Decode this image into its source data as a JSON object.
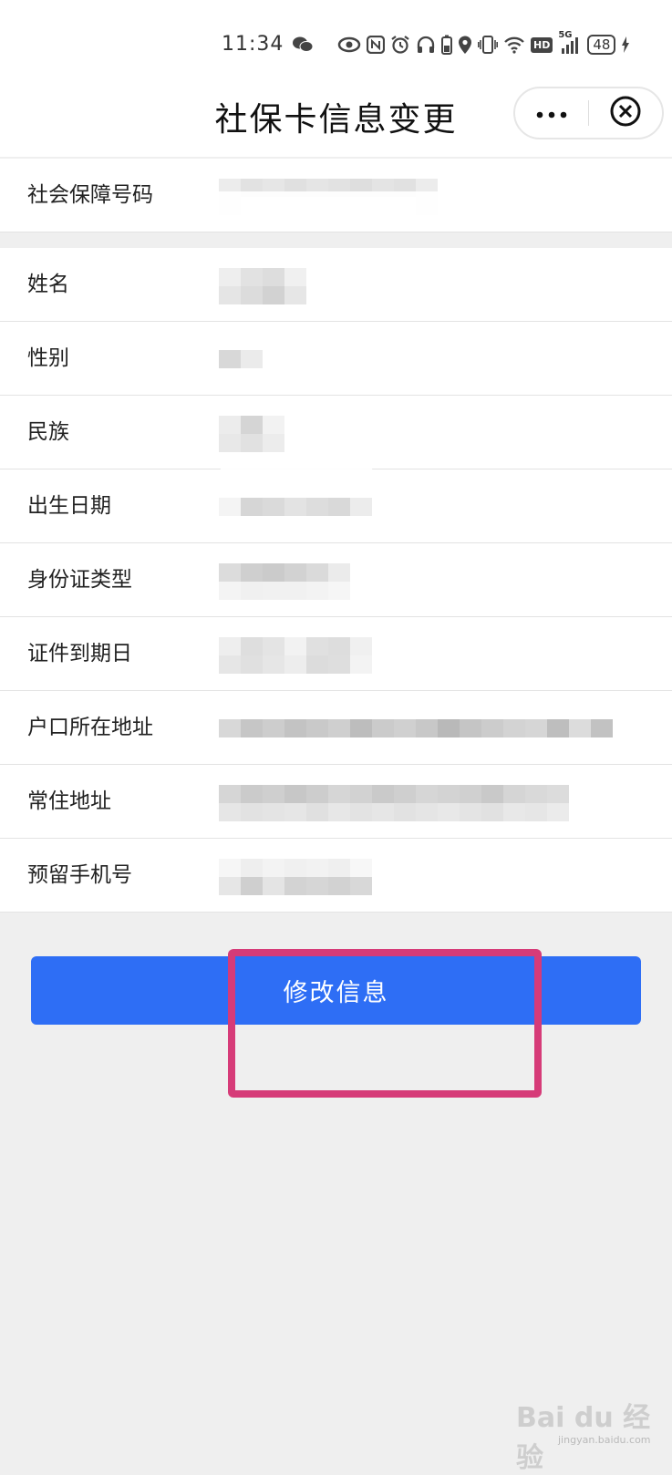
{
  "status_bar": {
    "time": "11:34",
    "network": "5G",
    "hd_label": "HD",
    "battery": "48",
    "icons": [
      "wechat-icon",
      "eye-icon",
      "nfc-icon",
      "alarm-icon",
      "headphones-icon",
      "battery-small-icon",
      "location-icon",
      "vibrate-icon",
      "wifi-icon",
      "hd-icon",
      "signal-icon",
      "charging-icon"
    ]
  },
  "nav": {
    "title": "社保卡信息变更",
    "more_icon": "more-icon",
    "close_icon": "close-icon"
  },
  "fields": {
    "ssn": "社会保障号码",
    "name": "姓名",
    "gender": "性别",
    "ethnicity": "民族",
    "birth_date": "出生日期",
    "id_type": "身份证类型",
    "id_expiry": "证件到期日",
    "hukou_address": "户口所在地址",
    "residence_address": "常住地址",
    "phone": "预留手机号"
  },
  "button": {
    "label": "修改信息"
  },
  "watermark": {
    "text": "Bai du 经验",
    "sub": "jingyan.baidu.com"
  },
  "colors": {
    "primary": "#2e6ef5",
    "highlight": "#d63b78",
    "background": "#efefef"
  }
}
